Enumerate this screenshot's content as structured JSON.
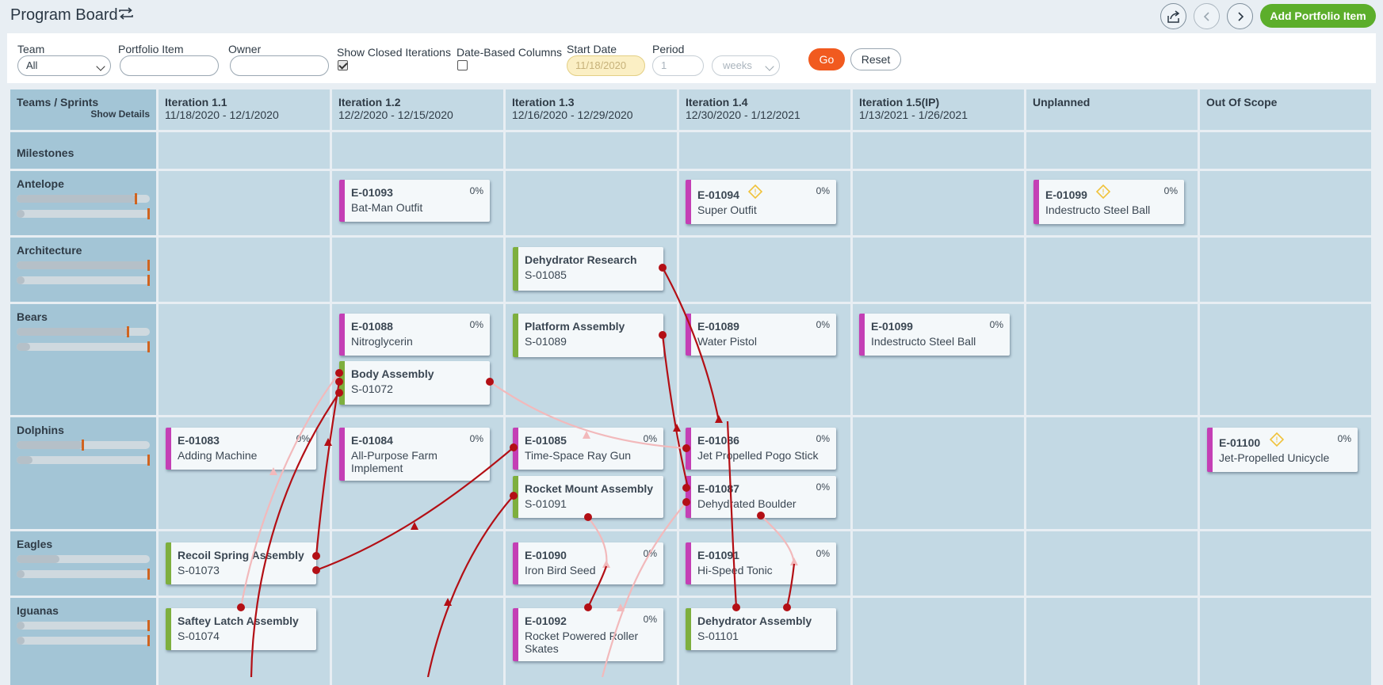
{
  "header": {
    "title": "Program Board",
    "add_label": "Add Portfolio Item"
  },
  "filters": {
    "team_label": "Team",
    "team_value": "All",
    "portfolio_label": "Portfolio Item",
    "portfolio_value": "",
    "owner_label": "Owner",
    "owner_value": "",
    "closed_label": "Show Closed Iterations",
    "closed_checked": true,
    "datecols_label": "Date-Based Columns",
    "datecols_checked": false,
    "start_label": "Start Date",
    "start_value": "11/18/2020",
    "period_label": "Period",
    "period_value": "1",
    "unit_value": "weeks",
    "go_label": "Go",
    "reset_label": "Reset"
  },
  "board": {
    "corner_title": "Teams / Sprints",
    "show_details": "Show Details",
    "columns": [
      {
        "title": "Iteration 1.1",
        "dates": "11/18/2020 - 12/1/2020"
      },
      {
        "title": "Iteration 1.2",
        "dates": "12/2/2020 - 12/15/2020"
      },
      {
        "title": "Iteration 1.3",
        "dates": "12/16/2020 - 12/29/2020"
      },
      {
        "title": "Iteration 1.4",
        "dates": "12/30/2020 - 1/12/2021"
      },
      {
        "title": "Iteration 1.5(IP)",
        "dates": "1/13/2021 - 1/26/2021"
      },
      {
        "title": "Unplanned",
        "dates": ""
      },
      {
        "title": "Out Of Scope",
        "dates": ""
      }
    ],
    "rows": [
      {
        "name": "Milestones",
        "bars": []
      },
      {
        "name": "Antelope",
        "bars": [
          {
            "fill": 0.9,
            "mark": 0.9
          },
          {
            "fill": 0.03,
            "mark": 1.0
          }
        ]
      },
      {
        "name": "Architecture",
        "bars": [
          {
            "fill": 1.0,
            "mark": 1.0
          },
          {
            "fill": 0.03,
            "mark": 1.0
          }
        ]
      },
      {
        "name": "Bears",
        "bars": [
          {
            "fill": 0.84,
            "mark": 0.84
          },
          {
            "fill": 0.1,
            "mark": 1.0
          }
        ]
      },
      {
        "name": "Dolphins",
        "bars": [
          {
            "fill": 0.5,
            "mark": 0.5
          },
          {
            "fill": 0.12,
            "mark": 1.0
          }
        ]
      },
      {
        "name": "Eagles",
        "bars": [
          {
            "fill": 0.32,
            "mark": null
          },
          {
            "fill": 0.03,
            "mark": 1.0
          }
        ]
      },
      {
        "name": "Iguanas",
        "bars": [
          {
            "fill": 0.05,
            "mark": 1.0
          },
          {
            "fill": 0.05,
            "mark": 1.0
          }
        ]
      }
    ],
    "cards": [
      {
        "id": "E-01093",
        "name": "Bat-Man Outfit",
        "pct": "0%",
        "type": "epic"
      },
      {
        "id": "E-01094",
        "name": "Super Outfit",
        "pct": "0%",
        "type": "epic",
        "warn": true
      },
      {
        "id": "E-01099",
        "name": "Indestructo Steel Ball",
        "pct": "0%",
        "type": "epic",
        "warn": true
      },
      {
        "id": "Dehydrator Research",
        "name": "S-01085",
        "pct": "",
        "type": "story"
      },
      {
        "id": "E-01088",
        "name": "Nitroglycerin",
        "pct": "0%",
        "type": "epic"
      },
      {
        "id": "Body Assembly",
        "name": "S-01072",
        "pct": "",
        "type": "story"
      },
      {
        "id": "Platform Assembly",
        "name": "S-01089",
        "pct": "",
        "type": "story"
      },
      {
        "id": "E-01089",
        "name": "Water Pistol",
        "pct": "0%",
        "type": "epic"
      },
      {
        "id": "E-01099",
        "name": "Indestructo Steel Ball",
        "pct": "0%",
        "type": "epic"
      },
      {
        "id": "E-01083",
        "name": "Adding Machine",
        "pct": "0%",
        "type": "epic"
      },
      {
        "id": "E-01084",
        "name": "All-Purpose Farm Implement",
        "pct": "0%",
        "type": "epic"
      },
      {
        "id": "E-01085",
        "name": "Time-Space Ray Gun",
        "pct": "0%",
        "type": "epic"
      },
      {
        "id": "Rocket Mount Assembly",
        "name": "S-01091",
        "pct": "",
        "type": "story"
      },
      {
        "id": "E-01086",
        "name": "Jet Propelled Pogo Stick",
        "pct": "0%",
        "type": "epic"
      },
      {
        "id": "E-01087",
        "name": "Dehydrated Boulder",
        "pct": "0%",
        "type": "epic"
      },
      {
        "id": "E-01100",
        "name": "Jet-Propelled Unicycle",
        "pct": "0%",
        "type": "epic",
        "warn": true
      },
      {
        "id": "Recoil Spring Assembly",
        "name": "S-01073",
        "pct": "",
        "type": "story"
      },
      {
        "id": "E-01090",
        "name": "Iron Bird Seed",
        "pct": "0%",
        "type": "epic"
      },
      {
        "id": "E-01091",
        "name": "Hi-Speed Tonic",
        "pct": "0%",
        "type": "epic"
      },
      {
        "id": "Saftey Latch Assembly",
        "name": "S-01074",
        "pct": "",
        "type": "story"
      },
      {
        "id": "E-01092",
        "name": "Rocket Powered Roller Skates",
        "pct": "0%",
        "type": "epic"
      },
      {
        "id": "Dehydrator Assembly",
        "name": "S-01101",
        "pct": "",
        "type": "story"
      }
    ]
  },
  "colors": {
    "epic": "#c43fb5",
    "story": "#7eaf3e",
    "dependency": "#b30f15",
    "go": "#f15a1f",
    "add": "#5cae2b"
  }
}
